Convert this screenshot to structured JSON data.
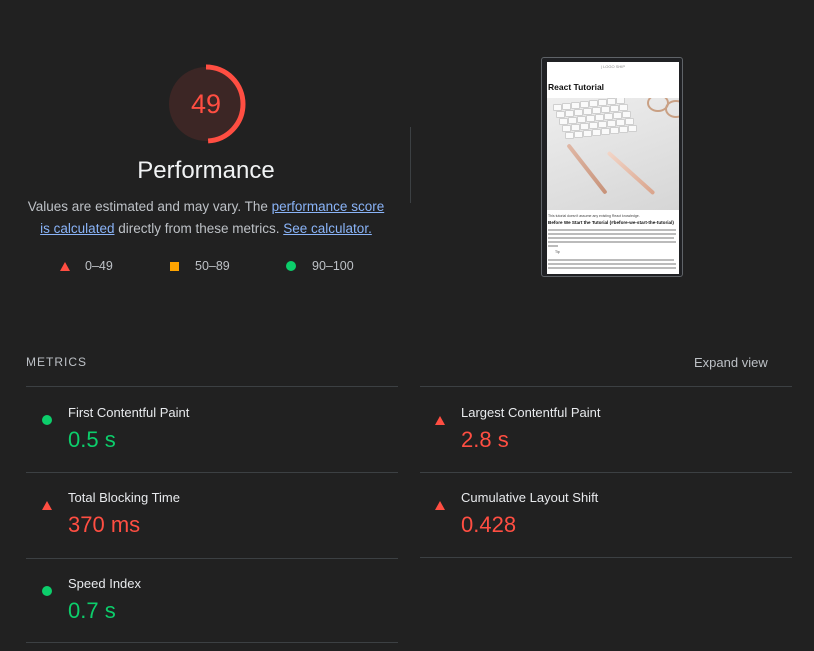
{
  "score": {
    "value": "49",
    "fraction": 0.49,
    "color": "#ff4e42",
    "title": "Performance"
  },
  "description": {
    "text1": "Values are estimated and may vary. The ",
    "link1": "performance score is calculated",
    "text2": " directly from these metrics. ",
    "link2": "See calculator."
  },
  "legend": [
    {
      "icon": "triangle-red",
      "range": "0–49"
    },
    {
      "icon": "square-orange",
      "range": "50–89"
    },
    {
      "icon": "circle-green",
      "range": "90–100"
    }
  ],
  "screenshot": {
    "top_text": "| LOGO SHIP",
    "title": "React Tutorial",
    "caption": "This tutorial doesn't assume any existing React knowledge.",
    "heading": "Before We Start the Tutorial (#before-we-start-the-tutorial)",
    "tip": "Tip"
  },
  "metrics": {
    "section_label": "METRICS",
    "expand_label": "Expand view",
    "items": [
      {
        "name": "First Contentful Paint",
        "value": "0.5 s",
        "status": "good"
      },
      {
        "name": "Largest Contentful Paint",
        "value": "2.8 s",
        "status": "poor"
      },
      {
        "name": "Total Blocking Time",
        "value": "370 ms",
        "status": "poor"
      },
      {
        "name": "Cumulative Layout Shift",
        "value": "0.428",
        "status": "poor"
      },
      {
        "name": "Speed Index",
        "value": "0.7 s",
        "status": "good"
      }
    ]
  },
  "colors": {
    "background": "#212121",
    "good": "#0cce6b",
    "average": "#ffa400",
    "poor": "#ff4e42",
    "link": "#8ab4f8"
  }
}
